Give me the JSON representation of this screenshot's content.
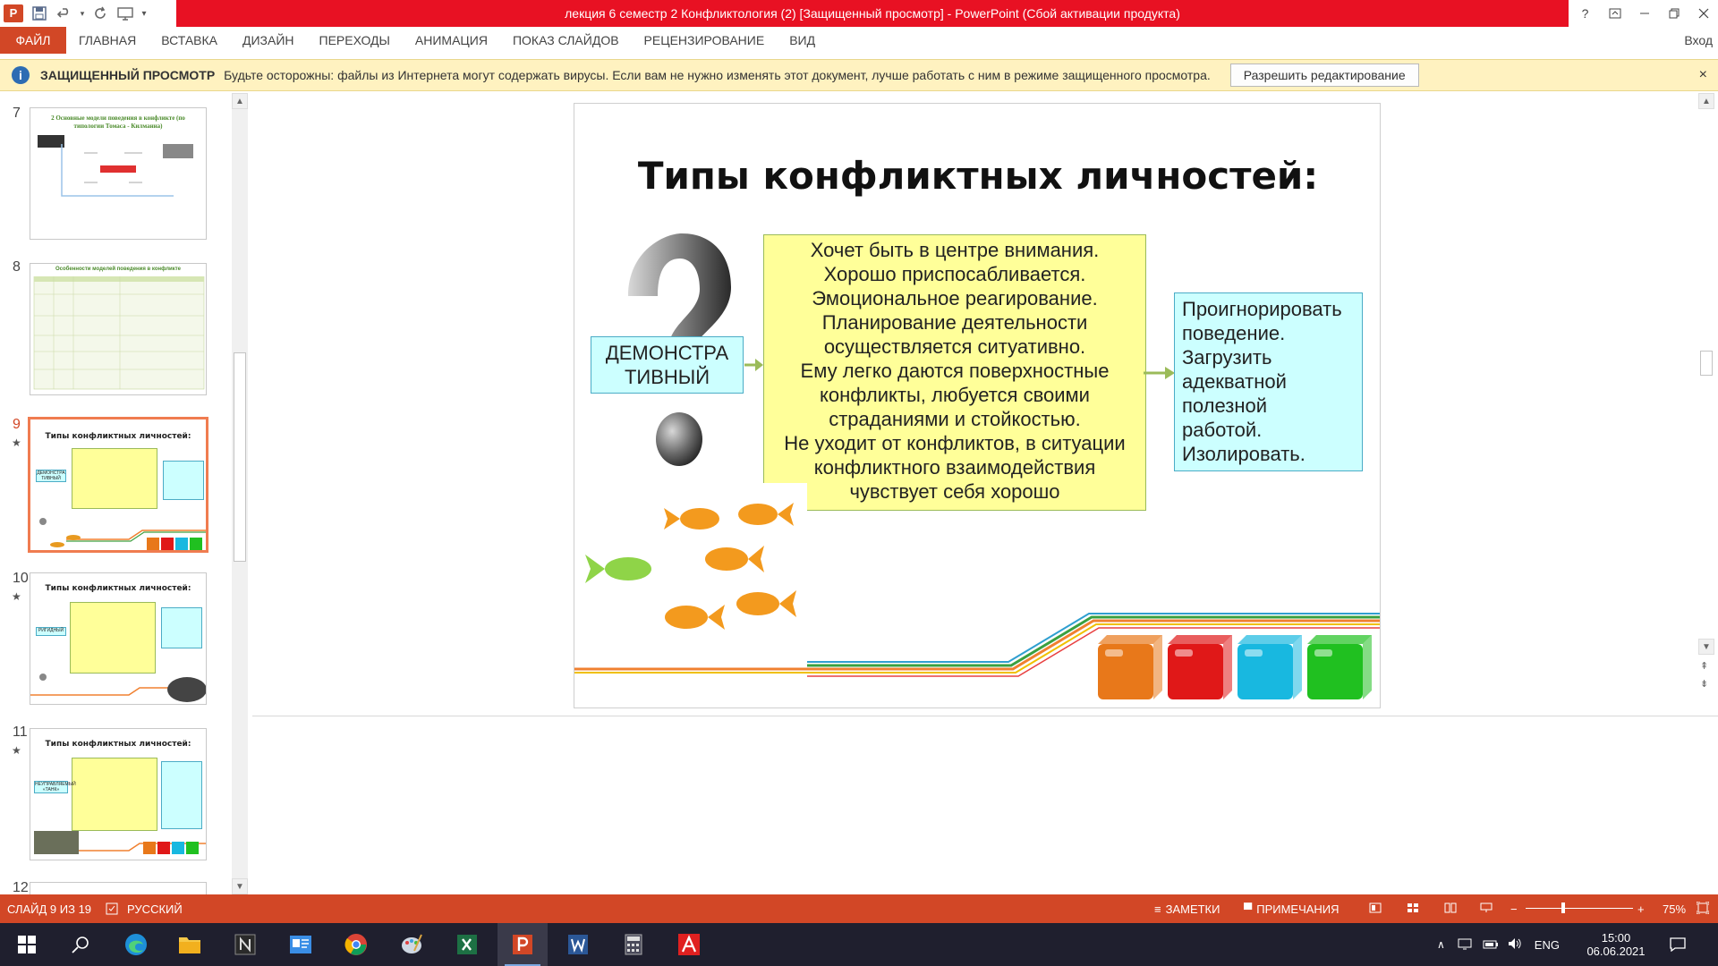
{
  "titlebar": {
    "title": "лекция 6 семестр 2 Конфликтология (2) [Защищенный просмотр] -  PowerPoint (Сбой активации продукта)",
    "app_icon_label": "P",
    "help": "?"
  },
  "ribbon": {
    "tabs": [
      "ФАЙЛ",
      "ГЛАВНАЯ",
      "ВСТАВКА",
      "ДИЗАЙН",
      "ПЕРЕХОДЫ",
      "АНИМАЦИЯ",
      "ПОКАЗ СЛАЙДОВ",
      "РЕЦЕНЗИРОВАНИЕ",
      "ВИД"
    ],
    "login": "Вход"
  },
  "protected_view": {
    "title": "ЗАЩИЩЕННЫЙ ПРОСМОТР",
    "message": "Будьте осторожны: файлы из Интернета могут содержать вирусы. Если вам не нужно изменять этот документ, лучше работать с ним в режиме защищенного просмотра.",
    "button": "Разрешить редактирование",
    "close": "×"
  },
  "thumbnails": [
    {
      "number": "7",
      "title": "2 Основные модели поведения в конфликте (по типологии Томаса - Килманна)",
      "active": false,
      "star": false
    },
    {
      "number": "8",
      "title": "Особенности моделей поведения в конфликте",
      "active": false,
      "star": false
    },
    {
      "number": "9",
      "title": "Типы конфликтных личностей:",
      "active": true,
      "star": true,
      "left_label": "ДЕМОНСТРА ТИВНЫЙ"
    },
    {
      "number": "10",
      "title": "Типы конфликтных личностей:",
      "active": false,
      "star": true,
      "left_label": "РИГИДНЫЙ"
    },
    {
      "number": "11",
      "title": "Типы конфликтных личностей:",
      "active": false,
      "star": true,
      "left_label": "НЕУПРАВЛЯЕМЫЙ «ТАНК»"
    },
    {
      "number": "12",
      "title": "",
      "active": false,
      "star": false
    }
  ],
  "slide": {
    "title": "Типы конфликтных личностей:",
    "left_box": "ДЕМОНСТРА ТИВНЫЙ",
    "main_box": [
      "Хочет быть в центре внимания.",
      "Хорошо приспосабливается.",
      "Эмоциональное реагирование.",
      "Планирование деятельности",
      "осуществляется ситуативно.",
      "Ему легко даются поверхностные",
      "конфликты, любуется своими",
      "страданиями и стойкостью.",
      "Не уходит от конфликтов, в ситуации",
      "конфликтного взаимодействия",
      "чувствует себя хорошо"
    ],
    "right_box": [
      "Проигнорировать",
      "поведение.",
      "Загрузить",
      "адекватной",
      "полезной",
      "работой.",
      "Изолировать."
    ],
    "cube_colors": [
      "#e8781a",
      "#e01818",
      "#18b8e0",
      "#20c020"
    ]
  },
  "statusbar": {
    "slide_info": "СЛАЙД 9 ИЗ 19",
    "language": "РУССКИЙ",
    "notes": "ЗАМЕТКИ",
    "comments": "ПРИМЕЧАНИЯ",
    "zoom": "75%"
  },
  "taskbar": {
    "language": "ENG",
    "time": "15:00",
    "date": "06.06.2021"
  },
  "colors": {
    "accent": "#d24726",
    "title_red": "#e81123",
    "protected_bar": "#fff2c0"
  }
}
